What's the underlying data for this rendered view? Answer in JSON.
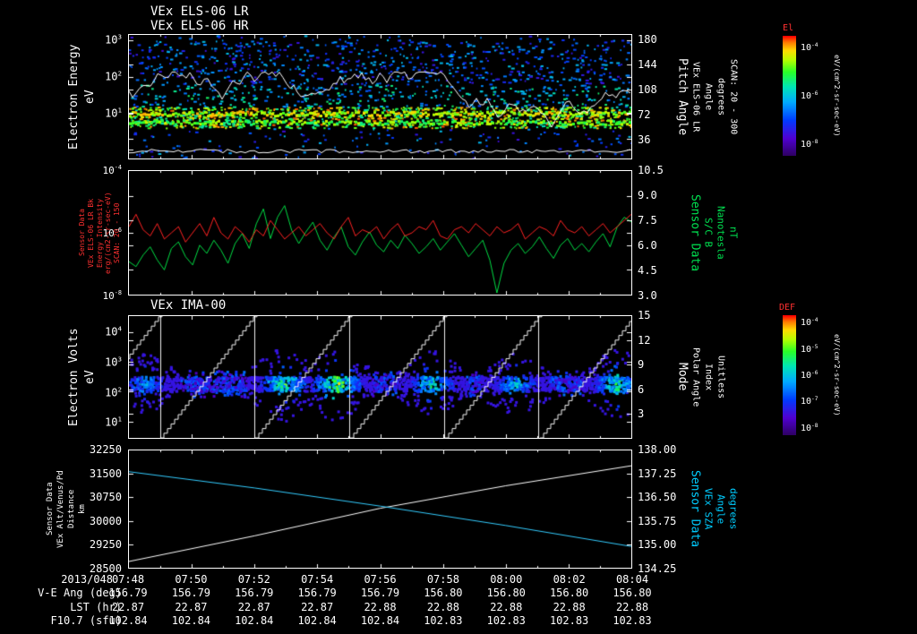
{
  "colors": {
    "background": "#000000",
    "text": "#ffffff",
    "red_text": "#ff3030",
    "green_text": "#00e050",
    "cyan_text": "#00ccff",
    "trace_red": "#ff2222",
    "trace_green": "#00dd44",
    "trace_white": "#ffffff",
    "trace_cyan": "#33ccff"
  },
  "panels": {
    "els": {
      "title_lr": "VEx ELS-06 LR",
      "title_hr": "VEx ELS-06 HR",
      "left_label": [
        "Electron Energy",
        "eV"
      ],
      "left_ticks_exp": [
        3,
        2,
        1
      ],
      "right_ticks": [
        180,
        144,
        108,
        72,
        36
      ],
      "right_labels": [
        "Pitch Angle",
        "VEx ELS-06 LR",
        "Angle",
        "degrees",
        "SCAN: 20 - 300"
      ],
      "colorbar": {
        "label": "El",
        "ticks_exp": [
          -4,
          -6,
          -8
        ],
        "units": "eV/(cm^2-sr-sec-eV)"
      }
    },
    "mag": {
      "left_labels": [
        "Sensor Data",
        "VEx ELS-06 LR Bk",
        "Energy Intensity",
        "erg/(cm2-sr-sec-eV)",
        "SCAN: 20 - 150"
      ],
      "left_ticks_exp": [
        -4,
        -6,
        -8
      ],
      "right_labels": [
        "Sensor Data",
        "S/C B",
        "Nanotesla",
        "nT"
      ],
      "right_ticks": [
        "10.5",
        "9.0",
        "7.5",
        "6.0",
        "4.5",
        "3.0"
      ]
    },
    "ima": {
      "title": "VEx IMA-00",
      "left_label": [
        "Electron Volts",
        "eV"
      ],
      "left_ticks_exp": [
        4,
        3,
        2,
        1
      ],
      "right_ticks": [
        15,
        12,
        9,
        6,
        3
      ],
      "right_labels": [
        "Mode",
        "Polar Angle",
        "Index",
        "Unitless"
      ],
      "colorbar": {
        "label": "DEF",
        "ticks_exp": [
          -4,
          -5,
          -6,
          -7,
          -8
        ],
        "units": "eV/(cm^2-sr-sec-eV)"
      }
    },
    "orbit": {
      "left_labels": [
        "Sensor Data",
        "VEx Alt/Venus/Pd",
        "Distance",
        "km"
      ],
      "left_ticks": [
        32250,
        31500,
        30750,
        30000,
        29250,
        28500
      ],
      "right_labels": [
        "Sensor Data",
        "VEx SZA",
        "Angle",
        "degrees"
      ],
      "right_ticks": [
        "138.00",
        "137.25",
        "136.50",
        "135.75",
        "135.00",
        "134.25"
      ]
    }
  },
  "xaxis": {
    "date": "2013/048",
    "ticks": [
      "07:48",
      "07:50",
      "07:52",
      "07:54",
      "07:56",
      "07:58",
      "08:00",
      "08:02",
      "08:04"
    ]
  },
  "rows": [
    {
      "label": "V-E Ang (deg)",
      "values": [
        "156.79",
        "156.79",
        "156.79",
        "156.79",
        "156.79",
        "156.80",
        "156.80",
        "156.80",
        "156.80"
      ]
    },
    {
      "label": "LST (hr)",
      "values": [
        "22.87",
        "22.87",
        "22.87",
        "22.87",
        "22.88",
        "22.88",
        "22.88",
        "22.88",
        "22.88"
      ]
    },
    {
      "label": "F10.7 (sfu)",
      "values": [
        "102.84",
        "102.84",
        "102.84",
        "102.84",
        "102.84",
        "102.83",
        "102.83",
        "102.83",
        "102.83"
      ]
    }
  ],
  "chart_data": [
    {
      "type": "heatmap",
      "title": "VEx ELS-06 LR / VEx ELS-06 HR electron energy spectrogram",
      "x_range": [
        "2013/048 07:48",
        "2013/048 08:04"
      ],
      "y_axis": {
        "label": "Electron Energy (eV)",
        "scale": "log",
        "ticks": [
          1000,
          100,
          10
        ]
      },
      "y2_axis": {
        "label": "Pitch Angle (degrees) SCAN: 20 - 300",
        "ticks": [
          180,
          144,
          108,
          72,
          36
        ]
      },
      "colorbar": {
        "label": "El",
        "units": "eV/(cm^2-sr-sec-eV)",
        "scale": "log",
        "ticks": [
          0.0001,
          1e-06,
          1e-08
        ]
      },
      "content_summary": "Bright continuous green/yellow electron flux band near 10-40 eV across whole interval; sparse cyan and blue speckle up to ~1 keV; jagged white overlay trace wandering through mid panel and a thin white trace near the bottom edge."
    },
    {
      "type": "line",
      "x_range": [
        "07:48",
        "08:04"
      ],
      "y_left": {
        "label": "ELS-06 LR Bk Energy Intensity erg/(cm2-sr-sec-eV)",
        "scale": "log",
        "ticks": [
          0.0001,
          1e-06,
          1e-08
        ]
      },
      "y_right": {
        "label": "S/C B (nT)",
        "ticks": [
          10.5,
          9.0,
          7.5,
          6.0,
          4.5,
          3.0
        ]
      },
      "series": [
        {
          "name": "ELS-06 LR Bk Energy Intensity",
          "axis": "left",
          "color": "#ff2222",
          "scale": "log_exp10",
          "values": [
            -5.8,
            -5.4,
            -5.9,
            -6.1,
            -5.7,
            -6.2,
            -6.0,
            -5.8,
            -6.3,
            -6.0,
            -5.7,
            -6.1,
            -5.5,
            -6.0,
            -6.2,
            -5.8,
            -6.0,
            -6.3,
            -5.9,
            -6.1,
            -5.6,
            -5.9,
            -6.2,
            -6.0,
            -5.8,
            -6.1,
            -5.9,
            -5.7,
            -6.0,
            -6.2,
            -5.8,
            -5.5,
            -6.1,
            -5.9,
            -6.0,
            -5.8,
            -6.2,
            -5.9,
            -5.7,
            -6.1,
            -6.0,
            -5.8,
            -5.9,
            -5.6,
            -6.1,
            -6.2,
            -5.9,
            -5.8,
            -6.0,
            -5.7,
            -5.9,
            -6.1,
            -5.8,
            -6.0,
            -5.9,
            -5.7,
            -6.2,
            -6.0,
            -5.8,
            -5.9,
            -6.1,
            -5.6,
            -5.9,
            -6.0,
            -5.8,
            -6.1,
            -5.9,
            -5.7,
            -6.0,
            -5.8,
            -5.6,
            -5.4
          ]
        },
        {
          "name": "S/C B",
          "axis": "right",
          "color": "#00dd44",
          "units": "nT",
          "values": [
            5.0,
            4.7,
            5.4,
            5.9,
            5.1,
            4.5,
            5.8,
            6.2,
            5.3,
            4.8,
            6.0,
            5.5,
            6.3,
            5.7,
            4.9,
            6.1,
            6.7,
            5.8,
            7.3,
            8.2,
            6.4,
            7.7,
            8.4,
            6.9,
            6.1,
            6.8,
            7.4,
            6.3,
            5.7,
            6.5,
            7.1,
            5.9,
            5.4,
            6.2,
            6.8,
            6.0,
            5.6,
            6.3,
            5.8,
            6.6,
            6.1,
            5.5,
            5.9,
            6.4,
            5.7,
            6.2,
            6.7,
            6.0,
            5.3,
            5.8,
            6.3,
            5.1,
            3.1,
            4.9,
            5.7,
            6.1,
            5.5,
            5.9,
            6.5,
            5.8,
            5.2,
            6.0,
            6.4,
            5.7,
            6.1,
            5.6,
            6.2,
            6.7,
            5.9,
            7.1,
            7.7,
            7.4
          ]
        }
      ]
    },
    {
      "type": "heatmap",
      "title": "VEx IMA-00 ion spectrogram",
      "x_range": [
        "07:48",
        "08:04"
      ],
      "y_axis": {
        "label": "Electron Volts (eV)",
        "scale": "log",
        "ticks": [
          10000,
          1000,
          100,
          10
        ]
      },
      "y2_axis": {
        "label": "Mode / Polar Angle / Index (Unitless)",
        "ticks": [
          15,
          12,
          9,
          6,
          3
        ]
      },
      "colorbar": {
        "label": "DEF",
        "units": "eV/(cm^2-sr-sec-eV)",
        "scale": "log",
        "ticks": [
          0.0001,
          1e-05,
          1e-06,
          1e-07,
          1e-08
        ]
      },
      "scan_boundaries_frac": [
        0.062,
        0.25,
        0.439,
        0.627,
        0.815
      ],
      "cluster_centers_frac": [
        0.03,
        0.305,
        0.412,
        0.6,
        0.767,
        0.97
      ],
      "content_summary": "Repeating ion scans separated by vertical white lines; white stepped sawtooth energy-sweep staircase in each scan; horizontal blue flux band near 100-1000 eV with bright green/yellow/red cores in each scan."
    },
    {
      "type": "line",
      "x_range": [
        "07:48",
        "08:04"
      ],
      "y_left": {
        "label": "VEx Alt/Venus/Pd Distance (km)",
        "range": [
          28500,
          32250
        ]
      },
      "y_right": {
        "label": "VEx SZA Angle (degrees)",
        "range": [
          134.25,
          138.0
        ]
      },
      "series": [
        {
          "name": "VEx Alt/Venus/Pd Distance",
          "axis": "left",
          "color": "#ffffff",
          "units": "km",
          "x_frac": [
            0,
            0.25,
            0.5,
            0.75,
            1
          ],
          "values": [
            28700,
            29520,
            30400,
            31120,
            31760
          ]
        },
        {
          "name": "VEx SZA Angle",
          "axis": "right",
          "color": "#33ccff",
          "units": "degrees",
          "x_frac": [
            0,
            0.25,
            0.5,
            0.75,
            1
          ],
          "values": [
            137.32,
            136.8,
            136.22,
            135.6,
            134.93
          ]
        }
      ]
    }
  ]
}
